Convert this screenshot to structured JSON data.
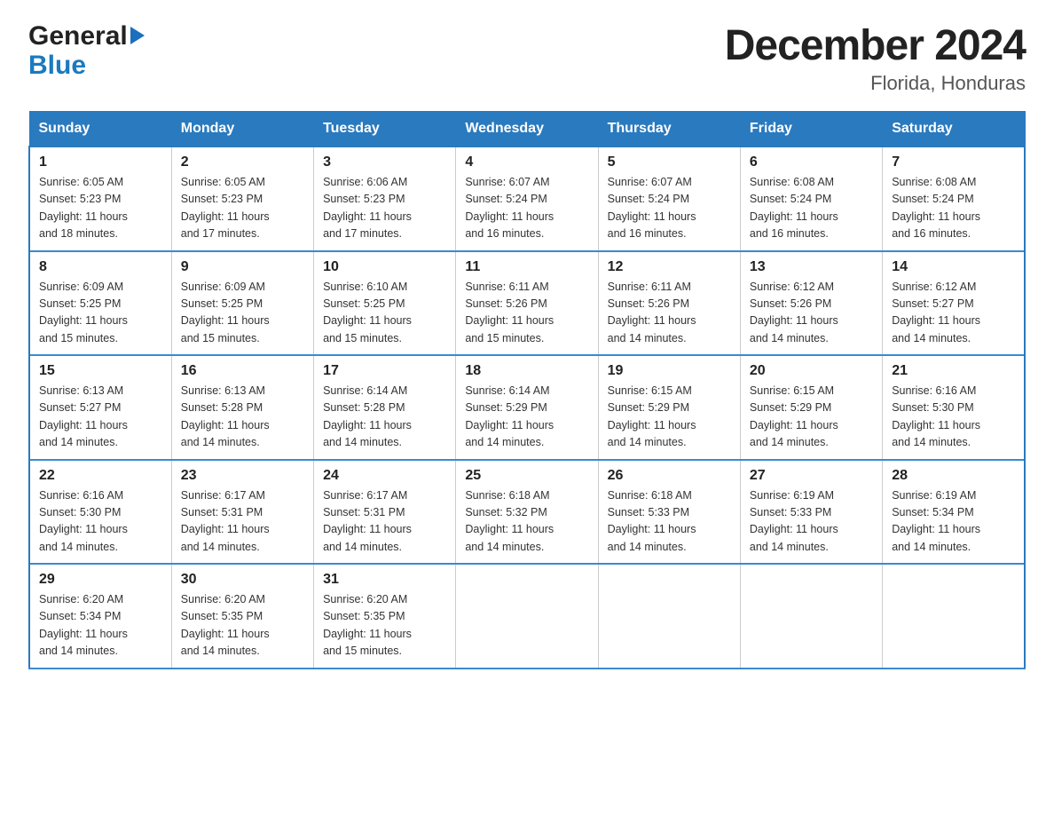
{
  "header": {
    "logo_general": "General",
    "logo_triangle": "▶",
    "logo_blue": "Blue",
    "month_title": "December 2024",
    "location": "Florida, Honduras"
  },
  "calendar": {
    "days_of_week": [
      "Sunday",
      "Monday",
      "Tuesday",
      "Wednesday",
      "Thursday",
      "Friday",
      "Saturday"
    ],
    "weeks": [
      [
        {
          "day": "1",
          "sunrise": "6:05 AM",
          "sunset": "5:23 PM",
          "daylight": "11 hours and 18 minutes."
        },
        {
          "day": "2",
          "sunrise": "6:05 AM",
          "sunset": "5:23 PM",
          "daylight": "11 hours and 17 minutes."
        },
        {
          "day": "3",
          "sunrise": "6:06 AM",
          "sunset": "5:23 PM",
          "daylight": "11 hours and 17 minutes."
        },
        {
          "day": "4",
          "sunrise": "6:07 AM",
          "sunset": "5:24 PM",
          "daylight": "11 hours and 16 minutes."
        },
        {
          "day": "5",
          "sunrise": "6:07 AM",
          "sunset": "5:24 PM",
          "daylight": "11 hours and 16 minutes."
        },
        {
          "day": "6",
          "sunrise": "6:08 AM",
          "sunset": "5:24 PM",
          "daylight": "11 hours and 16 minutes."
        },
        {
          "day": "7",
          "sunrise": "6:08 AM",
          "sunset": "5:24 PM",
          "daylight": "11 hours and 16 minutes."
        }
      ],
      [
        {
          "day": "8",
          "sunrise": "6:09 AM",
          "sunset": "5:25 PM",
          "daylight": "11 hours and 15 minutes."
        },
        {
          "day": "9",
          "sunrise": "6:09 AM",
          "sunset": "5:25 PM",
          "daylight": "11 hours and 15 minutes."
        },
        {
          "day": "10",
          "sunrise": "6:10 AM",
          "sunset": "5:25 PM",
          "daylight": "11 hours and 15 minutes."
        },
        {
          "day": "11",
          "sunrise": "6:11 AM",
          "sunset": "5:26 PM",
          "daylight": "11 hours and 15 minutes."
        },
        {
          "day": "12",
          "sunrise": "6:11 AM",
          "sunset": "5:26 PM",
          "daylight": "11 hours and 14 minutes."
        },
        {
          "day": "13",
          "sunrise": "6:12 AM",
          "sunset": "5:26 PM",
          "daylight": "11 hours and 14 minutes."
        },
        {
          "day": "14",
          "sunrise": "6:12 AM",
          "sunset": "5:27 PM",
          "daylight": "11 hours and 14 minutes."
        }
      ],
      [
        {
          "day": "15",
          "sunrise": "6:13 AM",
          "sunset": "5:27 PM",
          "daylight": "11 hours and 14 minutes."
        },
        {
          "day": "16",
          "sunrise": "6:13 AM",
          "sunset": "5:28 PM",
          "daylight": "11 hours and 14 minutes."
        },
        {
          "day": "17",
          "sunrise": "6:14 AM",
          "sunset": "5:28 PM",
          "daylight": "11 hours and 14 minutes."
        },
        {
          "day": "18",
          "sunrise": "6:14 AM",
          "sunset": "5:29 PM",
          "daylight": "11 hours and 14 minutes."
        },
        {
          "day": "19",
          "sunrise": "6:15 AM",
          "sunset": "5:29 PM",
          "daylight": "11 hours and 14 minutes."
        },
        {
          "day": "20",
          "sunrise": "6:15 AM",
          "sunset": "5:29 PM",
          "daylight": "11 hours and 14 minutes."
        },
        {
          "day": "21",
          "sunrise": "6:16 AM",
          "sunset": "5:30 PM",
          "daylight": "11 hours and 14 minutes."
        }
      ],
      [
        {
          "day": "22",
          "sunrise": "6:16 AM",
          "sunset": "5:30 PM",
          "daylight": "11 hours and 14 minutes."
        },
        {
          "day": "23",
          "sunrise": "6:17 AM",
          "sunset": "5:31 PM",
          "daylight": "11 hours and 14 minutes."
        },
        {
          "day": "24",
          "sunrise": "6:17 AM",
          "sunset": "5:31 PM",
          "daylight": "11 hours and 14 minutes."
        },
        {
          "day": "25",
          "sunrise": "6:18 AM",
          "sunset": "5:32 PM",
          "daylight": "11 hours and 14 minutes."
        },
        {
          "day": "26",
          "sunrise": "6:18 AM",
          "sunset": "5:33 PM",
          "daylight": "11 hours and 14 minutes."
        },
        {
          "day": "27",
          "sunrise": "6:19 AM",
          "sunset": "5:33 PM",
          "daylight": "11 hours and 14 minutes."
        },
        {
          "day": "28",
          "sunrise": "6:19 AM",
          "sunset": "5:34 PM",
          "daylight": "11 hours and 14 minutes."
        }
      ],
      [
        {
          "day": "29",
          "sunrise": "6:20 AM",
          "sunset": "5:34 PM",
          "daylight": "11 hours and 14 minutes."
        },
        {
          "day": "30",
          "sunrise": "6:20 AM",
          "sunset": "5:35 PM",
          "daylight": "11 hours and 14 minutes."
        },
        {
          "day": "31",
          "sunrise": "6:20 AM",
          "sunset": "5:35 PM",
          "daylight": "11 hours and 15 minutes."
        },
        null,
        null,
        null,
        null
      ]
    ],
    "labels": {
      "sunrise": "Sunrise:",
      "sunset": "Sunset:",
      "daylight": "Daylight:"
    }
  }
}
